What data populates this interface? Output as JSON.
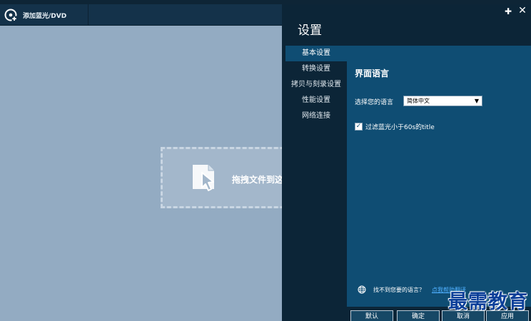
{
  "toolbar": {
    "add_label": "添加蓝光/DVD"
  },
  "workspace": {
    "drop_text": "拖拽文件到这"
  },
  "settings": {
    "title": "设置",
    "nav": [
      "基本设置",
      "转换设置",
      "拷贝与刻录设置",
      "性能设置",
      "网络连接"
    ],
    "active_nav": "基本设置",
    "section_title": "界面语言",
    "language_label": "选择您的语言",
    "language_value": "简体中文",
    "filter_checked": true,
    "filter_label": "过滤蓝光小于60s的title",
    "help_text": "找不到您要的语言？",
    "help_link": "点我帮助翻译",
    "buttons": {
      "default": "默认",
      "ok": "确定",
      "cancel": "取消",
      "apply": "应用"
    }
  },
  "watermark": "最需教育",
  "colors": {
    "workspace_bg": "#93abc2",
    "panel_bg": "#0c2537",
    "content_bg": "#0f4d73",
    "watermark": "#0b3f99"
  },
  "icons": [
    "bluray-disc-icon",
    "file-drop-icon",
    "pin-icon",
    "close-icon",
    "globe-icon",
    "chevron-down-icon",
    "check-icon"
  ]
}
